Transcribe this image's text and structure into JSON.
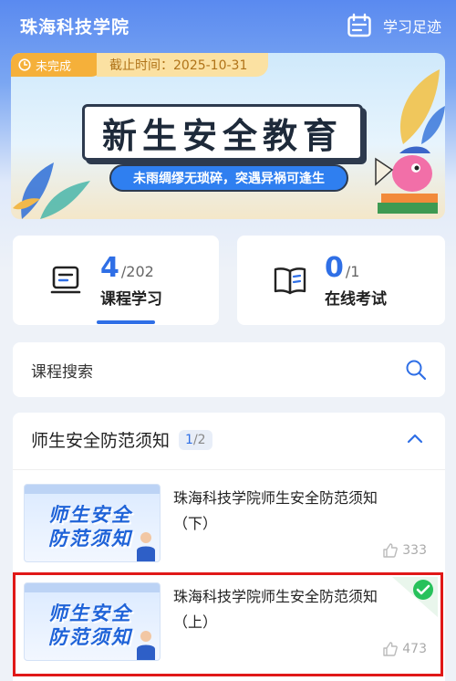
{
  "header": {
    "title": "珠海科技学院",
    "footprint_label": "学习足迹"
  },
  "banner": {
    "status": "未完成",
    "deadline": "截止时间：2025-10-31",
    "title": "新生安全教育",
    "subtitle": "未雨绸缪无琐碎，突遇异祸可逢生"
  },
  "stats": {
    "course": {
      "done": "4",
      "total": "/202",
      "label": "课程学习"
    },
    "exam": {
      "done": "0",
      "total": "/1",
      "label": "在线考试"
    }
  },
  "search": {
    "label": "课程搜索"
  },
  "section": {
    "title": "师生安全防范须知",
    "done": "1",
    "total": "/2",
    "items": [
      {
        "thumb_line1": "师生安全",
        "thumb_line2": "防范须知",
        "title": "珠海科技学院师生安全防范须知",
        "sub": "（下）",
        "likes": "333"
      },
      {
        "thumb_line1": "师生安全",
        "thumb_line2": "防范须知",
        "title": "珠海科技学院师生安全防范须知",
        "sub": "（上）",
        "likes": "473"
      }
    ]
  },
  "colors": {
    "accent": "#2f6fe6",
    "status_pill": "#f5b03a",
    "done_badge": "#27c15b",
    "highlight": "#e01818"
  }
}
